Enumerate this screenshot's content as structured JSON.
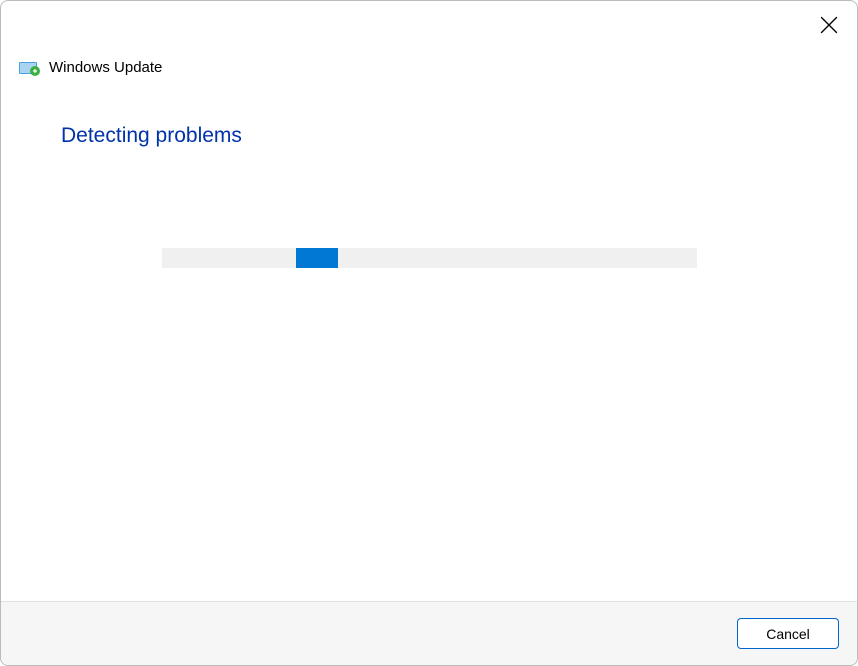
{
  "header": {
    "app_title": "Windows Update"
  },
  "content": {
    "heading": "Detecting problems"
  },
  "footer": {
    "cancel_label": "Cancel"
  },
  "colors": {
    "accent": "#0078d4",
    "heading": "#0033aa"
  }
}
